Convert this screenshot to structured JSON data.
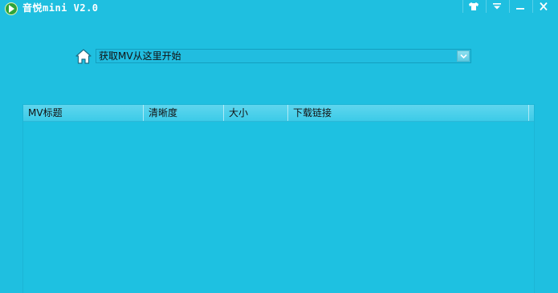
{
  "window": {
    "title": "音悦mini V2.0",
    "controls": [
      {
        "name": "skin-icon"
      },
      {
        "name": "menu-icon"
      },
      {
        "name": "minimize-icon"
      },
      {
        "name": "close-icon"
      }
    ]
  },
  "url_bar": {
    "value": "获取MV从这里开始"
  },
  "list": {
    "columns": [
      "MV标题",
      "清晰度",
      "大小",
      "下载链接"
    ],
    "rows": []
  },
  "colors": {
    "background": "#1fbfe0",
    "header": "#5fd6ee",
    "logo": "#2ea43a"
  }
}
